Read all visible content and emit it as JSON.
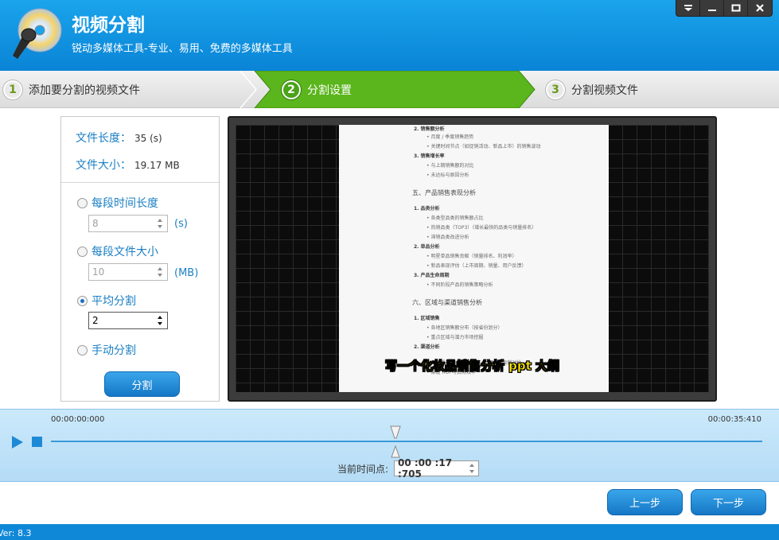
{
  "app": {
    "title": "视频分割",
    "subtitle": "锐动多媒体工具-专业、易用、免费的多媒体工具"
  },
  "window_controls": [
    "menu-icon",
    "minimize-icon",
    "maximize-icon",
    "close-icon"
  ],
  "steps": [
    {
      "num": "1",
      "label": "添加要分割的视频文件",
      "active": false
    },
    {
      "num": "2",
      "label": "分割设置",
      "active": true
    },
    {
      "num": "3",
      "label": "分割视频文件",
      "active": false
    }
  ],
  "file_info": {
    "length_label": "文件长度：",
    "length_value": "35 (s)",
    "size_label": "文件大小：",
    "size_value": "19.17 MB"
  },
  "options": {
    "per_duration": {
      "label": "每段时间长度",
      "value": "8",
      "unit": "(s)",
      "selected": false
    },
    "per_size": {
      "label": "每段文件大小",
      "value": "10",
      "unit": "(MB)",
      "selected": false
    },
    "even": {
      "label": "平均分割",
      "value": "2",
      "selected": true
    },
    "manual": {
      "label": "手动分割",
      "selected": false
    }
  },
  "split_button": "分割",
  "video": {
    "caption": "写一个化妆品销售分析 ppt 大纲",
    "doc_lines": [
      "2. 销售额分析",
      "• 月度 / 季度销售趋势",
      "• 关键时间节点（如促销活动、新品上市）的销售波动",
      "3. 销售增长率",
      "• 与上期销售额的对比",
      "• 未达标与原因分析",
      "五、产品销售表现分析",
      "1. 品类分析",
      "• 各类型品类的销售额占比",
      "• 热销品类（TOP3）（增长最快的品类与销量排名）",
      "• 滞销品类改进分析",
      "2. 单品分析",
      "• 明星单品销售贡献（销量排名、利润率）",
      "• 新品表现评估（上市周期、销量、用户反馈）",
      "3. 产品生命周期",
      "• 不同阶段产品的销售策略分析",
      "六、区域与渠道销售分析",
      "1. 区域销售",
      "• 各地区销售额分布（按省份划分）",
      "• 重点区域与潜力市场挖掘",
      "2. 渠道分析",
      "• 各个渠道（线上、线下、代理商）贡献对比",
      "• 渠道 ROI 与费用效率"
    ]
  },
  "timeline": {
    "start_time": "00:00:00:000",
    "end_time": "00:00:35:410",
    "current_label": "当前时间点:",
    "current_value": "00 :00 :17 :705",
    "position_fraction": 0.5
  },
  "nav": {
    "prev": "上一步",
    "next": "下一步"
  },
  "status": {
    "version": "Ver: 8.3"
  },
  "colors": {
    "header": "#0a84d6",
    "accent_green": "#4aa318",
    "label_blue": "#1a7fc4",
    "caption_yellow": "#ffe800"
  }
}
